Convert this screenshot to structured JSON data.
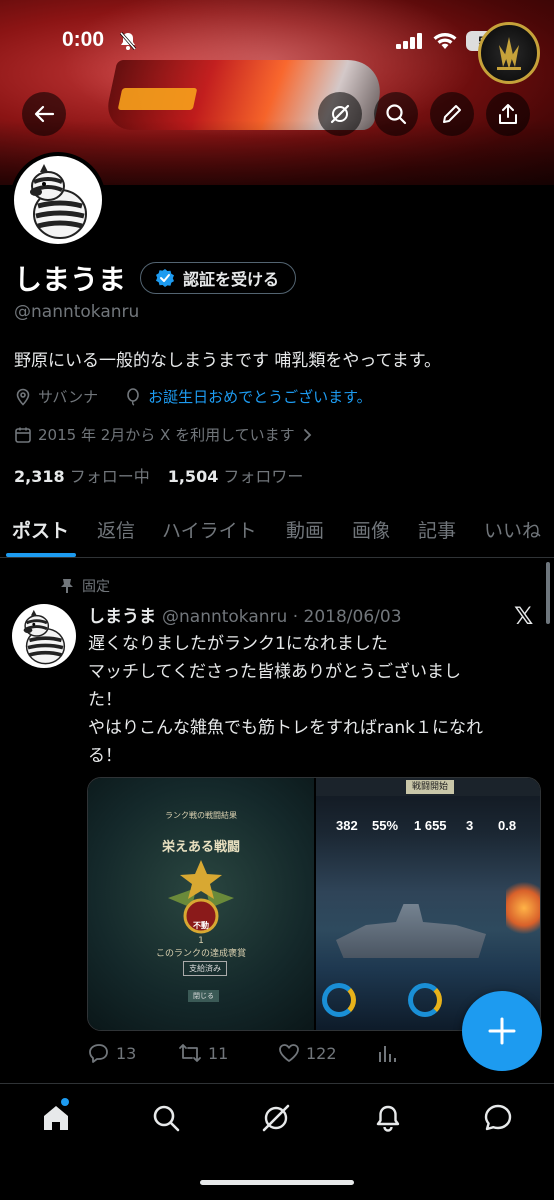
{
  "status_bar": {
    "time": "0:00",
    "battery": "53"
  },
  "header": {
    "back_icon": "arrow-left-icon",
    "grok_icon": "grok-icon",
    "search_icon": "search-icon",
    "edit_icon": "pencil-icon",
    "share_icon": "share-icon"
  },
  "profile": {
    "name": "しまうま",
    "verify_label": "認証を受ける",
    "handle": "@nanntokanru",
    "bio": "野原にいる一般的なしまうまです 哺乳類をやってます。",
    "location": "サバンナ",
    "birthday_text": "お誕生日おめでとうございます。",
    "joined": "2015 年 2月から X を利用しています",
    "following_count": "2,318",
    "following_label": "フォロー中",
    "followers_count": "1,504",
    "followers_label": "フォロワー"
  },
  "tabs": [
    "ポスト",
    "返信",
    "ハイライト",
    "動画",
    "画像",
    "記事",
    "いいね"
  ],
  "pinned_post": {
    "pinned_label": "固定",
    "author_name": "しまうま",
    "author_handle": "@nanntokanru",
    "separator": "·",
    "date": "2018/06/03",
    "text_lines": [
      "遅くなりましたがランク1になれました",
      "マッチしてくださった皆様ありがとうございまし",
      "た！",
      "やはりこんな雑魚でも筋トレをすればrank１になれ",
      "る！"
    ],
    "media_left": {
      "header": "ランク戦の戦闘結果",
      "title": "栄えある戦闘",
      "rank_number": "1",
      "rank_caption": "このランクの達成褒賞",
      "badge_label": "不動",
      "button_label": "支給済み",
      "footer_button": "閉じる"
    },
    "media_right": {
      "battle_label": "戦闘開始",
      "stats": [
        "382",
        "55%",
        "1 655",
        "3",
        "0.8"
      ]
    },
    "replies": "13",
    "reposts": "11",
    "likes": "122"
  },
  "fab": {
    "icon": "plus-icon"
  },
  "bottom_nav": {
    "items": [
      "home-icon",
      "search-icon",
      "grok-icon",
      "bell-icon",
      "messages-icon"
    ]
  },
  "colors": {
    "accent": "#1d9bf0",
    "background": "#000000",
    "muted": "#71767b"
  }
}
